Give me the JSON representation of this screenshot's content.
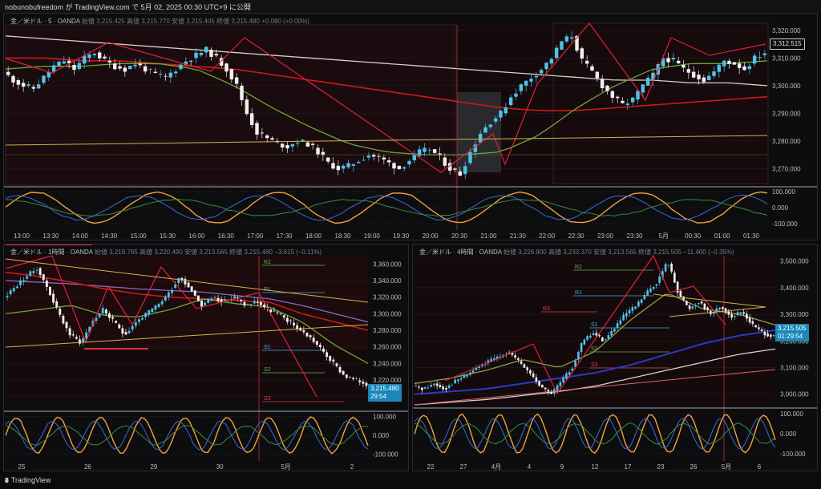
{
  "header": {
    "publish_text": "nobunobufreedom が TradingView.com で 5月 02, 2025 00:30 UTC+9 に公開"
  },
  "footer": {
    "brand": "TradingView"
  },
  "colors": {
    "up": "#4fc3e8",
    "down": "#f0f0f0",
    "accent_red": "#e0203a",
    "ema_red": "#d01818",
    "ema_white": "#d8d0c8",
    "ema_green": "#6aa83a",
    "osc_orange": "#f2a23a",
    "osc_blue": "#3a6ad8"
  },
  "chart_data": [
    {
      "name": "top",
      "type": "line",
      "legend": {
        "symbol": "金／米ドル · 5 · OANDA",
        "open_label": "始値",
        "open": "3,215.425",
        "high_label": "高値",
        "high": "3,215.770",
        "low_label": "安値",
        "low": "3,215.405",
        "close_label": "終値",
        "close": "3,215.480",
        "change": "+0.080 (+0.00%)"
      },
      "x_ticks": [
        "13:00",
        "13:30",
        "14:00",
        "14:30",
        "15:00",
        "15:30",
        "16:00",
        "16:30",
        "17:00",
        "17:30",
        "18:00",
        "18:30",
        "19:00",
        "19:30",
        "20:00",
        "20:30",
        "21:00",
        "21:30",
        "22:00",
        "22:30",
        "23:00",
        "23:30",
        "5月",
        "00:30",
        "01:00",
        "01:30"
      ],
      "y_ticks": [
        "3,320.000",
        "3,310.000",
        "3,300.000",
        "3,290.000",
        "3,280.000",
        "3,270.000"
      ],
      "ylim": [
        3264,
        3322
      ],
      "price_label": "3,312.515",
      "osc_ticks": [
        "100.000",
        "0.000",
        "-100.000"
      ],
      "close_path": [
        3305,
        3302,
        3300,
        3299,
        3303,
        3307,
        3309,
        3306,
        3310,
        3312,
        3309,
        3307,
        3306,
        3308,
        3306,
        3304,
        3303,
        3306,
        3309,
        3311,
        3313,
        3310,
        3306,
        3300,
        3290,
        3283,
        3281,
        3279,
        3278,
        3280,
        3279,
        3276,
        3272,
        3270,
        3271,
        3273,
        3275,
        3274,
        3272,
        3270,
        3273,
        3276,
        3277,
        3274,
        3270,
        3268,
        3276,
        3283,
        3287,
        3290,
        3296,
        3300,
        3303,
        3306,
        3310,
        3316,
        3318,
        3309,
        3305,
        3300,
        3296,
        3293,
        3295,
        3300,
        3304,
        3310,
        3309,
        3306,
        3304,
        3302,
        3305,
        3309,
        3308,
        3306,
        3310,
        3312
      ],
      "ema_red": [
        3310,
        3310,
        3309,
        3309,
        3308,
        3307,
        3306,
        3304,
        3302,
        3300,
        3298,
        3296,
        3294,
        3292,
        3291,
        3291,
        3292,
        3293,
        3294,
        3295,
        3296
      ],
      "ema_white": [
        3318,
        3317,
        3316,
        3315,
        3314,
        3313,
        3312,
        3311,
        3310,
        3309,
        3308,
        3307,
        3306,
        3305,
        3304,
        3303,
        3302,
        3302,
        3301,
        3301,
        3300
      ],
      "ema_green": [
        3306,
        3307,
        3307,
        3308,
        3308,
        3306,
        3300,
        3292,
        3285,
        3279,
        3276,
        3275,
        3275,
        3276,
        3282,
        3292,
        3300,
        3306,
        3308,
        3308,
        3309
      ]
    },
    {
      "name": "bottom-left",
      "type": "line",
      "legend": {
        "symbol": "金／米ドル · 1時間 · OANDA",
        "open_label": "始値",
        "open": "3,219.765",
        "high_label": "高値",
        "high": "3,220.490",
        "low_label": "安値",
        "low": "3,213.565",
        "close_label": "終値",
        "close": "3,215.480",
        "change": "−3.615 (−0.11%)"
      },
      "x_ticks": [
        "25",
        "26",
        "29",
        "30",
        "5月",
        "2"
      ],
      "y_ticks": [
        "3,360.000",
        "3,340.000",
        "3,320.000",
        "3,300.000",
        "3,280.000",
        "3,260.000",
        "3,240.000",
        "3,220.000",
        "3,200.000"
      ],
      "ylim": [
        3192,
        3370
      ],
      "price_label": "3,215.480",
      "countdown": "29:54",
      "osc_ticks": [
        "100.000",
        "0.000",
        "-100.000"
      ],
      "levels": [
        "R2",
        "R1",
        "S1",
        "S2",
        "S3"
      ],
      "close_path": [
        3320,
        3332,
        3345,
        3355,
        3330,
        3300,
        3275,
        3265,
        3290,
        3305,
        3290,
        3275,
        3290,
        3300,
        3310,
        3325,
        3345,
        3330,
        3310,
        3320,
        3315,
        3320,
        3310,
        3315,
        3305,
        3300,
        3290,
        3280,
        3270,
        3255,
        3240,
        3225,
        3220,
        3215
      ]
    },
    {
      "name": "bottom-right",
      "type": "line",
      "legend": {
        "symbol": "金／米ドル · 4時間 · OANDA",
        "open_label": "始値",
        "open": "3,226.900",
        "high_label": "高値",
        "high": "3,233.370",
        "low_label": "安値",
        "low": "3,213.565",
        "close_label": "終値",
        "close": "3,215.505",
        "change": "−11.400 (−0.35%)"
      },
      "x_ticks": [
        "22",
        "27",
        "4月",
        "4",
        "9",
        "12",
        "17",
        "23",
        "26",
        "5月",
        "6"
      ],
      "y_ticks": [
        "3,500.000",
        "3,400.000",
        "3,300.000",
        "3,200.000",
        "3,100.000",
        "3,000.000"
      ],
      "ylim": [
        2960,
        3520
      ],
      "price_label": "3,215.505",
      "countdown": "01:29:54",
      "osc_ticks": [
        "100.000",
        "0.000",
        "-100.000"
      ],
      "levels": [
        "R3",
        "R2",
        "R1",
        "S1",
        "S2",
        "S3"
      ],
      "close_path": [
        3030,
        3020,
        3040,
        3020,
        3050,
        3070,
        3100,
        3120,
        3140,
        3160,
        3120,
        3080,
        3030,
        3000,
        3050,
        3100,
        3200,
        3230,
        3200,
        3250,
        3300,
        3330,
        3380,
        3420,
        3500,
        3380,
        3320,
        3350,
        3300,
        3330,
        3290,
        3310,
        3260,
        3230,
        3215
      ]
    }
  ]
}
